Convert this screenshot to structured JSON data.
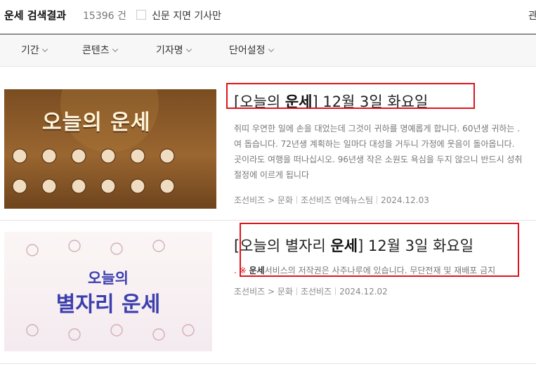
{
  "header": {
    "title_keyword": "운세",
    "title_suffix": "검색결과",
    "count": "15396 건",
    "newspaper_only_label": "신문 지면 기사만",
    "corner_text": "관"
  },
  "filters": [
    {
      "label": "기간"
    },
    {
      "label": "콘텐츠"
    },
    {
      "label": "기자명"
    },
    {
      "label": "단어설정"
    }
  ],
  "articles": [
    {
      "thumb_text": "오늘의 운세",
      "title_pre": "[오늘의 ",
      "title_bold": "운세",
      "title_post": "] 12월 3일 화요일",
      "snippet_lines": [
        "쥐띠 우연한 일에 손을 대었는데 그것이 귀하를 명예롭게 합니다. 60년생 귀하는 .",
        "여 돕습니다. 72년생 계획하는 일마다 대성을 거두니 가정에 웃음이 돌아옵니다.",
        "곳이라도 여행을 떠나십시오. 96년생 작은 소원도 욕심을 두지 않으니 반드시 성취",
        "절정에 이르게 됩니다"
      ],
      "section": "조선비즈 > 문화",
      "desk": "조선비즈 연예뉴스팀",
      "date": "2024.12.03"
    },
    {
      "thumb_text_1": "오늘의",
      "thumb_text_2": "별자리 운세",
      "title_pre": "[오늘의 별자리 ",
      "title_bold": "운세",
      "title_post": "] 12월 3일 화요일",
      "snippet_prefix": ". ※ ",
      "snippet_bold": "운세",
      "snippet_rest": "서비스의 저작권은 사주나루에 있습니다. 무단전재 및 재배포 금지",
      "section": "조선비즈 > 문화",
      "desk": "조선비즈",
      "date": "2024.12.02"
    }
  ],
  "colors": {
    "highlight_box": "#e0141e",
    "thumb1_bg": "#8a5a2a",
    "thumb2_text": "#3b3fae"
  }
}
